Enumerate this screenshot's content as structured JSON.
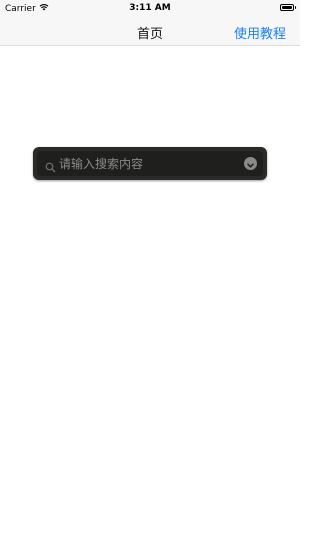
{
  "status_bar": {
    "carrier": "Carrier",
    "time": "3:11 AM",
    "wifi_icon": "wifi-icon",
    "battery_icon": "battery-icon"
  },
  "nav": {
    "title": "首页",
    "right_button": "使用教程"
  },
  "search": {
    "placeholder": "请输入搜索内容",
    "value": "",
    "icon": "search-icon",
    "dropdown_icon": "chevron-down-icon"
  },
  "colors": {
    "accent": "#1a7ff5",
    "bar_background": "#f7f7f7",
    "search_background": "#2a2a28"
  }
}
